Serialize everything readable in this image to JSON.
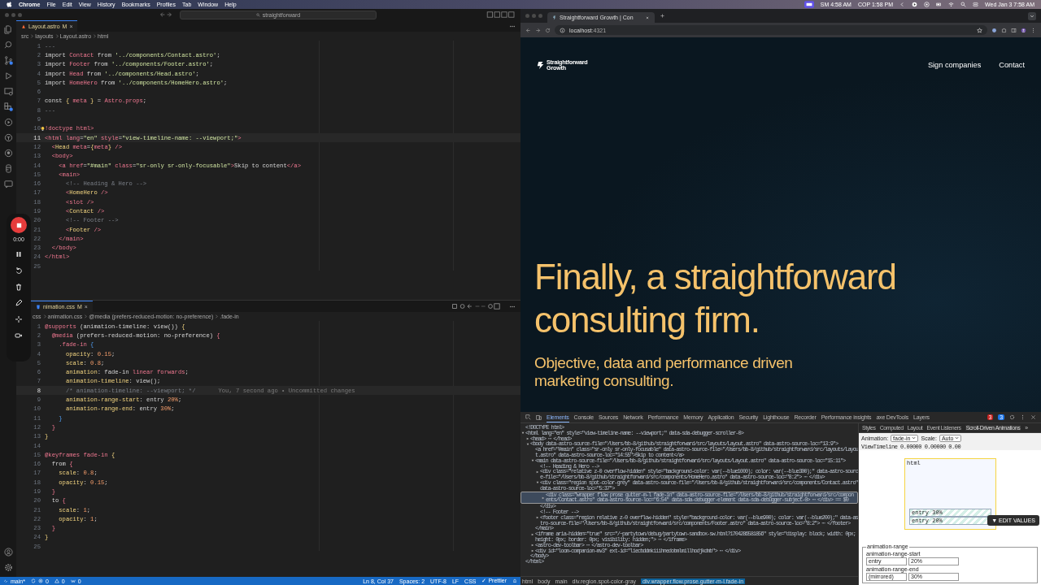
{
  "menu_bar": {
    "app": "Chrome",
    "items": [
      "File",
      "Edit",
      "View",
      "History",
      "Bookmarks",
      "Profiles",
      "Tab",
      "Window",
      "Help"
    ],
    "status": [
      "SM 4:58 AM",
      "COP 1:58 PM"
    ],
    "clock": "Wed Jan 3  7:58 AM"
  },
  "editor_window": {
    "search": "straightforward",
    "editors": [
      {
        "kind": "astro",
        "tab": "Layout.astro",
        "tab_status": "M",
        "close": "×",
        "breadcrumbs": [
          "src",
          "layouts",
          "Layout.astro",
          "html"
        ],
        "lines": [
          {
            "n": "1",
            "current": false,
            "tokens": [
              {
                "kind": "c",
                "text": "---"
              }
            ]
          },
          {
            "n": "2",
            "current": false,
            "tokens": [
              {
                "kind": "p",
                "text": "import "
              },
              {
                "kind": "r",
                "text": "Contact"
              },
              {
                "kind": "p",
                "text": " from "
              },
              {
                "kind": "s",
                "text": "'../components/Contact.astro'"
              },
              {
                "kind": "p",
                "text": ";"
              }
            ]
          },
          {
            "n": "3",
            "current": false,
            "tokens": [
              {
                "kind": "p",
                "text": "import "
              },
              {
                "kind": "r",
                "text": "Footer"
              },
              {
                "kind": "p",
                "text": " from "
              },
              {
                "kind": "s",
                "text": "'../components/Footer.astro'"
              },
              {
                "kind": "p",
                "text": ";"
              }
            ]
          },
          {
            "n": "4",
            "current": false,
            "tokens": [
              {
                "kind": "p",
                "text": "import "
              },
              {
                "kind": "r",
                "text": "Head"
              },
              {
                "kind": "p",
                "text": " from "
              },
              {
                "kind": "s",
                "text": "'../components/Head.astro'"
              },
              {
                "kind": "p",
                "text": ";"
              }
            ]
          },
          {
            "n": "5",
            "current": false,
            "tokens": [
              {
                "kind": "p",
                "text": "import "
              },
              {
                "kind": "r",
                "text": "HomeHero"
              },
              {
                "kind": "p",
                "text": " from "
              },
              {
                "kind": "s",
                "text": "'../components/HomeHero.astro'"
              },
              {
                "kind": "p",
                "text": ";"
              }
            ]
          },
          {
            "n": "6",
            "current": false
          },
          {
            "n": "7",
            "current": false,
            "tokens": [
              {
                "kind": "p",
                "text": "const "
              },
              {
                "kind": "y",
                "text": "{ "
              },
              {
                "kind": "r",
                "text": "meta"
              },
              {
                "kind": "y",
                "text": " }"
              },
              {
                "kind": "p",
                "text": " = "
              },
              {
                "kind": "r",
                "text": "Astro.props"
              },
              {
                "kind": "p",
                "text": ";"
              }
            ]
          },
          {
            "n": "8",
            "current": false,
            "tokens": [
              {
                "kind": "c",
                "text": "---"
              }
            ]
          },
          {
            "n": "9",
            "current": false
          },
          {
            "n": "10",
            "current": false,
            "bulb": true,
            "tokens": [
              {
                "kind": "r",
                "text": "!doctype html>"
              }
            ]
          },
          {
            "n": "11",
            "current": true,
            "tokens": [
              {
                "kind": "r",
                "text": "<html lang"
              },
              {
                "kind": "p",
                "text": "="
              },
              {
                "kind": "s",
                "text": "\"en\""
              },
              {
                "kind": "r",
                "text": " style"
              },
              {
                "kind": "p",
                "text": "="
              },
              {
                "kind": "s",
                "text": "\"view-timeline-name: --viewport;\""
              },
              {
                "kind": "r",
                "text": ">"
              }
            ]
          },
          {
            "n": "12",
            "current": false,
            "tokens": [
              {
                "kind": "r",
                "text": "  <"
              },
              {
                "kind": "y",
                "text": "Head"
              },
              {
                "kind": "r",
                "text": " meta"
              },
              {
                "kind": "p",
                "text": "="
              },
              {
                "kind": "y",
                "text": "{"
              },
              {
                "kind": "r",
                "text": "meta"
              },
              {
                "kind": "y",
                "text": "}"
              },
              {
                "kind": "r",
                "text": " />"
              }
            ]
          },
          {
            "n": "13",
            "current": false,
            "tokens": [
              {
                "kind": "r",
                "text": "  <body>"
              }
            ]
          },
          {
            "n": "14",
            "current": false,
            "tokens": [
              {
                "kind": "r",
                "text": "    <a href"
              },
              {
                "kind": "p",
                "text": "="
              },
              {
                "kind": "s",
                "text": "\"#main\""
              },
              {
                "kind": "r",
                "text": " class"
              },
              {
                "kind": "p",
                "text": "="
              },
              {
                "kind": "s",
                "text": "\"sr-only sr-only-focusable\""
              },
              {
                "kind": "r",
                "text": ">"
              },
              {
                "kind": "p",
                "text": "Skip to content"
              },
              {
                "kind": "r",
                "text": "</a>"
              }
            ]
          },
          {
            "n": "15",
            "current": false,
            "tokens": [
              {
                "kind": "r",
                "text": "    <main>"
              }
            ]
          },
          {
            "n": "16",
            "current": false,
            "tokens": [
              {
                "kind": "c",
                "text": "      <!-- Heading & Hero -->"
              }
            ]
          },
          {
            "n": "17",
            "current": false,
            "tokens": [
              {
                "kind": "r",
                "text": "      <"
              },
              {
                "kind": "y",
                "text": "HomeHero"
              },
              {
                "kind": "r",
                "text": " />"
              }
            ]
          },
          {
            "n": "18",
            "current": false,
            "tokens": [
              {
                "kind": "r",
                "text": "      <slot />"
              }
            ]
          },
          {
            "n": "19",
            "current": false,
            "tokens": [
              {
                "kind": "r",
                "text": "      <"
              },
              {
                "kind": "y",
                "text": "Contact"
              },
              {
                "kind": "r",
                "text": " />"
              }
            ]
          },
          {
            "n": "20",
            "current": false,
            "tokens": [
              {
                "kind": "c",
                "text": "      <!-- Footer -->"
              }
            ]
          },
          {
            "n": "21",
            "current": false,
            "tokens": [
              {
                "kind": "r",
                "text": "      <"
              },
              {
                "kind": "y",
                "text": "Footer"
              },
              {
                "kind": "r",
                "text": " />"
              }
            ]
          },
          {
            "n": "22",
            "current": false,
            "tokens": [
              {
                "kind": "r",
                "text": "    </main>"
              }
            ]
          },
          {
            "n": "23",
            "current": false,
            "tokens": [
              {
                "kind": "r",
                "text": "  </body>"
              }
            ]
          },
          {
            "n": "24",
            "current": false,
            "tokens": [
              {
                "kind": "r",
                "text": "</html>"
              }
            ]
          },
          {
            "n": "25",
            "current": false
          }
        ]
      },
      {
        "kind": "css",
        "tab": "nimation.css",
        "tab_status": "M",
        "close": "×",
        "breadcrumbs": [
          "css",
          "animation.css",
          "@media (prefers-reduced-motion: no-preference)",
          ".fade-in"
        ],
        "lines": [
          {
            "n": "1",
            "current": false,
            "tokens": [
              {
                "kind": "r",
                "text": "@supports"
              },
              {
                "kind": "p",
                "text": " (animation-timeline: view()) "
              },
              {
                "kind": "y",
                "text": "{"
              }
            ]
          },
          {
            "n": "2",
            "current": false,
            "tokens": [
              {
                "kind": "r",
                "text": "  @media"
              },
              {
                "kind": "p",
                "text": " (prefers-reduced-motion: no-preference) "
              },
              {
                "kind": "r",
                "text": "{"
              }
            ]
          },
          {
            "n": "3",
            "current": false,
            "tokens": [
              {
                "kind": "r",
                "text": "    .fade-in"
              },
              {
                "kind": "b",
                "text": " {"
              }
            ]
          },
          {
            "n": "4",
            "current": false,
            "tokens": [
              {
                "kind": "y",
                "text": "      opacity"
              },
              {
                "kind": "p",
                "text": ": "
              },
              {
                "kind": "n",
                "text": "0.15"
              },
              {
                "kind": "p",
                "text": ";"
              }
            ]
          },
          {
            "n": "5",
            "current": false,
            "tokens": [
              {
                "kind": "y",
                "text": "      scale"
              },
              {
                "kind": "p",
                "text": ": "
              },
              {
                "kind": "n",
                "text": "0.8"
              },
              {
                "kind": "p",
                "text": ";"
              }
            ]
          },
          {
            "n": "6",
            "current": false,
            "tokens": [
              {
                "kind": "y",
                "text": "      animation"
              },
              {
                "kind": "p",
                "text": ": fade-in "
              },
              {
                "kind": "r",
                "text": "linear forwards"
              },
              {
                "kind": "p",
                "text": ";"
              }
            ]
          },
          {
            "n": "7",
            "current": false,
            "tokens": [
              {
                "kind": "y",
                "text": "      animation-timeline"
              },
              {
                "kind": "p",
                "text": ": view();"
              }
            ]
          },
          {
            "n": "8",
            "current": true,
            "tokens": [
              {
                "kind": "c",
                "text": "      /* animation-timeline: --viewport; */"
              }
            ],
            "blame": "You, 7 second ago • Uncommitted changes"
          },
          {
            "n": "9",
            "current": false,
            "tokens": [
              {
                "kind": "y",
                "text": "      animation-range-start"
              },
              {
                "kind": "p",
                "text": ": entry "
              },
              {
                "kind": "n",
                "text": "20%"
              },
              {
                "kind": "p",
                "text": ";"
              }
            ]
          },
          {
            "n": "10",
            "current": false,
            "tokens": [
              {
                "kind": "y",
                "text": "      animation-range-end"
              },
              {
                "kind": "p",
                "text": ": entry "
              },
              {
                "kind": "n",
                "text": "30%"
              },
              {
                "kind": "p",
                "text": ";"
              }
            ]
          },
          {
            "n": "11",
            "current": false,
            "tokens": [
              {
                "kind": "b",
                "text": "    }"
              }
            ]
          },
          {
            "n": "12",
            "current": false,
            "tokens": [
              {
                "kind": "r",
                "text": "  }"
              }
            ]
          },
          {
            "n": "13",
            "current": false,
            "tokens": [
              {
                "kind": "y",
                "text": "}"
              }
            ]
          },
          {
            "n": "14",
            "current": false
          },
          {
            "n": "15",
            "current": false,
            "tokens": [
              {
                "kind": "r",
                "text": "@keyframes fade-in "
              },
              {
                "kind": "y",
                "text": "{"
              }
            ]
          },
          {
            "n": "16",
            "current": false,
            "tokens": [
              {
                "kind": "p",
                "text": "  from "
              },
              {
                "kind": "r",
                "text": "{"
              }
            ]
          },
          {
            "n": "17",
            "current": false,
            "tokens": [
              {
                "kind": "y",
                "text": "    scale"
              },
              {
                "kind": "p",
                "text": ": "
              },
              {
                "kind": "n",
                "text": "0.8"
              },
              {
                "kind": "p",
                "text": ";"
              }
            ]
          },
          {
            "n": "18",
            "current": false,
            "tokens": [
              {
                "kind": "y",
                "text": "    opacity"
              },
              {
                "kind": "p",
                "text": ": "
              },
              {
                "kind": "n",
                "text": "0.15"
              },
              {
                "kind": "p",
                "text": ";"
              }
            ]
          },
          {
            "n": "19",
            "current": false,
            "tokens": [
              {
                "kind": "r",
                "text": "  }"
              }
            ]
          },
          {
            "n": "20",
            "current": false,
            "tokens": [
              {
                "kind": "p",
                "text": "  to "
              },
              {
                "kind": "r",
                "text": "{"
              }
            ]
          },
          {
            "n": "21",
            "current": false,
            "tokens": [
              {
                "kind": "y",
                "text": "    scale"
              },
              {
                "kind": "p",
                "text": ": "
              },
              {
                "kind": "n",
                "text": "1"
              },
              {
                "kind": "p",
                "text": ";"
              }
            ]
          },
          {
            "n": "22",
            "current": false,
            "tokens": [
              {
                "kind": "y",
                "text": "    opacity"
              },
              {
                "kind": "p",
                "text": ": "
              },
              {
                "kind": "n",
                "text": "1"
              },
              {
                "kind": "p",
                "text": ";"
              }
            ]
          },
          {
            "n": "23",
            "current": false,
            "tokens": [
              {
                "kind": "r",
                "text": "  }"
              }
            ]
          },
          {
            "n": "24",
            "current": false,
            "tokens": [
              {
                "kind": "y",
                "text": "}"
              }
            ]
          },
          {
            "n": "25",
            "current": false
          }
        ]
      }
    ],
    "status_bar": {
      "branch": "main*",
      "errors": "0",
      "warnings": "0",
      "ports": "0",
      "right": [
        "Ln 8, Col 37",
        "Spaces: 2",
        "UTF-8",
        "LF",
        "CSS",
        "✓ Prettier"
      ]
    }
  },
  "recorder": {
    "timer": "0:00"
  },
  "browser": {
    "tab_title": "Straightforward Growth | Con",
    "url_host": "localhost",
    "url_port": ":4321",
    "site": {
      "logo": [
        "Straightforward",
        "Growth"
      ],
      "nav": [
        "Sign companies",
        "Contact"
      ],
      "heading": [
        "Finally, a straightforward",
        "consulting firm."
      ],
      "subtitle": [
        "Objective, data and performance driven",
        "marketing consulting."
      ]
    }
  },
  "devtools": {
    "tabs": [
      {
        "label": "Elements",
        "selected": true
      },
      {
        "label": "Console",
        "selected": false
      },
      {
        "label": "Sources",
        "selected": false
      },
      {
        "label": "Network",
        "selected": false
      },
      {
        "label": "Performance",
        "selected": false
      },
      {
        "label": "Memory",
        "selected": false
      },
      {
        "label": "Application",
        "selected": false
      },
      {
        "label": "Security",
        "selected": false
      },
      {
        "label": "Lighthouse",
        "selected": false
      },
      {
        "label": "Recorder",
        "selected": false
      },
      {
        "label": "Performance insights",
        "selected": false
      },
      {
        "label": "axe DevTools",
        "selected": false
      },
      {
        "label": "Layers",
        "selected": false
      }
    ],
    "errors": "3",
    "messages": "3",
    "elements": [
      {
        "text": "<!DOCTYPE html>",
        "selected": false
      },
      {
        "text": "<html lang=\"en\" style=\"view-timeline-name: --viewport;\" data-sda-debugger-scroller-0>",
        "selected": false,
        "expanded": true,
        "children": [
          {
            "text": "<head> ⋯ </head>",
            "selected": false,
            "expanded": false
          },
          {
            "text": "<body data-astro-source-file=\"/Users/bb-8/github/straightforward/src/layouts/Layout.astro\" data-astro-source-loc=\"13:9\">",
            "selected": false,
            "expanded": true,
            "children": [
              {
                "text": "<a href=\"#main\" class=\"sr-only sr-only-focusable\" data-astro-source-file=\"/Users/bb-8/github/straightforward/src/layouts/Layout.astro\" data-astro-source-loc=\"14:55\">Skip to content</a>",
                "selected": false
              },
              {
                "text": "<main data-astro-source-file=\"/Users/bb-8/github/straightforward/src/layouts/Layout.astro\" data-astro-source-loc=\"15:11\">",
                "selected": false,
                "expanded": true,
                "children": [
                  {
                    "text": "<!-- Heading & Hero -->",
                    "selected": false
                  },
                  {
                    "text": "<div class=\"relative z-0 overflow-hidden\" style=\"background-color: var(--blue1000); color: var(--blue300);\" data-astro-source-file=\"/Users/bb-8/github/straightforward/src/components/HomeHero.astro\" data-astro-source-loc=\"8:2\"> ⋯ </div>",
                    "selected": false,
                    "expanded": false
                  },
                  {
                    "text": "<div class=\"region spot-color-grey\" data-astro-source-file=\"/Users/bb-8/github/straightforward/src/components/Contact.astro\" data-astro-source-loc=\"5:37\">",
                    "selected": false,
                    "expanded": true,
                    "children": [
                      {
                        "text": "<div class=\"wrapper flow prose gutter-m-l fade-in\" data-astro-source-file=\"/Users/bb-8/github/straightforward/src/components/Contact.astro\" data-astro-source-loc=\"6:54\" data-sda-debugger-element data-sda-debugger-subject-0> ⋯ </div> == $0",
                        "selected": true,
                        "expanded": false
                      }
                    ]
                  },
                  {
                    "text": "</div>",
                    "selected": false
                  },
                  {
                    "text": "<!-- Footer -->",
                    "selected": false
                  },
                  {
                    "text": "<footer class=\"region relative z-0 overflow-hidden\" style=\"background-color: var(--blue900); color: var(--blue200);\" data-astro-source-file=\"/Users/bb-8/github/straightforward/src/components/Footer.astro\" data-astro-source-loc=\"8:2\"> ⋯ </footer>",
                    "selected": false,
                    "expanded": false
                  }
                ]
              },
              {
                "text": "</main>",
                "selected": false
              },
              {
                "text": "<iframe aria-hidden=\"true\" src=\"/~partytown/debug/partytown-sandbox-sw.html?1704286581856\" style=\"display: block; width: 0px; height: 0px; border: 0px; visibility: hidden;\"> ⋯ </iframe>",
                "selected": false,
                "expanded": false
              },
              {
                "text": "<astro-dev-toolbar> ⋯ </astro-dev-toolbar>",
                "selected": false,
                "expanded": false
              },
              {
                "text": "<div id=\"loom-companion-mv3\" ext-id=\"liecbddmkiiihnedobmlmillhodjkdmb\"> ⋯ </div>",
                "selected": false,
                "expanded": false
              }
            ]
          },
          {
            "text": "</body>",
            "selected": false
          }
        ]
      },
      {
        "text": "</html>",
        "selected": false
      }
    ],
    "crumbs": [
      {
        "label": "html",
        "selected": false
      },
      {
        "label": "body",
        "selected": false
      },
      {
        "label": "main",
        "selected": false
      },
      {
        "label": "div.region.spot-color-gray",
        "selected": false
      },
      {
        "label": "div.wrapper.flow.prose.gutter-m-l.fade-in",
        "selected": true
      }
    ],
    "side_tabs": [
      {
        "label": "Styles",
        "selected": false
      },
      {
        "label": "Computed",
        "selected": false
      },
      {
        "label": "Layout",
        "selected": false
      },
      {
        "label": "Event Listeners",
        "selected": false
      },
      {
        "label": "Scroll-Driven Animations",
        "selected": true
      },
      {
        "label": "»",
        "selected": false
      }
    ],
    "animation": {
      "animation_label": "Animation:",
      "animation": "fade-in",
      "scale_label": "Scale:",
      "scale": "Auto",
      "timeline": "ViewTimeline 0.00000 0.00000 0.00",
      "box_label": "html",
      "ranges": [
        "entry 30%",
        "entry 20%"
      ],
      "edit_button": "▼ EDIT VALUES",
      "fieldset": "animation-range",
      "start_label": "animation-range-start",
      "start_select": "entry",
      "start_value": "20%",
      "end_label": "animation-range-end",
      "end_select": "(mirrored)",
      "end_value": "30%"
    }
  }
}
